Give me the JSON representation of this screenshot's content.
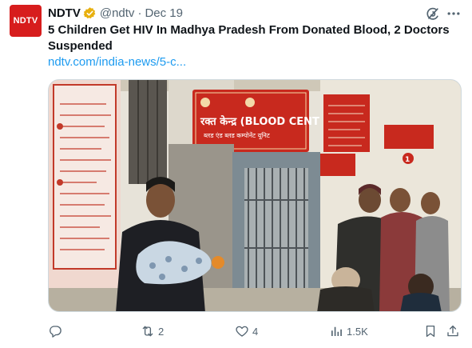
{
  "avatar": {
    "label": "NDTV",
    "color": "#d71d1d"
  },
  "author": {
    "name": "NDTV",
    "handle": "@ndtv",
    "separator": "·",
    "date": "Dec 19"
  },
  "tweet": {
    "text": "5 Children Get HIV In Madhya Pradesh From Donated Blood, 2 Doctors Suspended",
    "link_text": "ndtv.com/india-news/5-c..."
  },
  "media": {
    "signs": {
      "blood_centre_hindi": "रक्त केन्द्र (BLOOD CENTRE)",
      "blood_centre_sub": "ब्लड एंड ब्लड कम्पोनेंट यूनिट",
      "right_sign_number": "1"
    }
  },
  "actions": {
    "reply_count": "",
    "repost_count": "2",
    "like_count": "4",
    "views_count": "1.5K"
  },
  "colors": {
    "link": "#1d9bf0",
    "secondary": "#536471",
    "verified": "#e8b00e"
  }
}
